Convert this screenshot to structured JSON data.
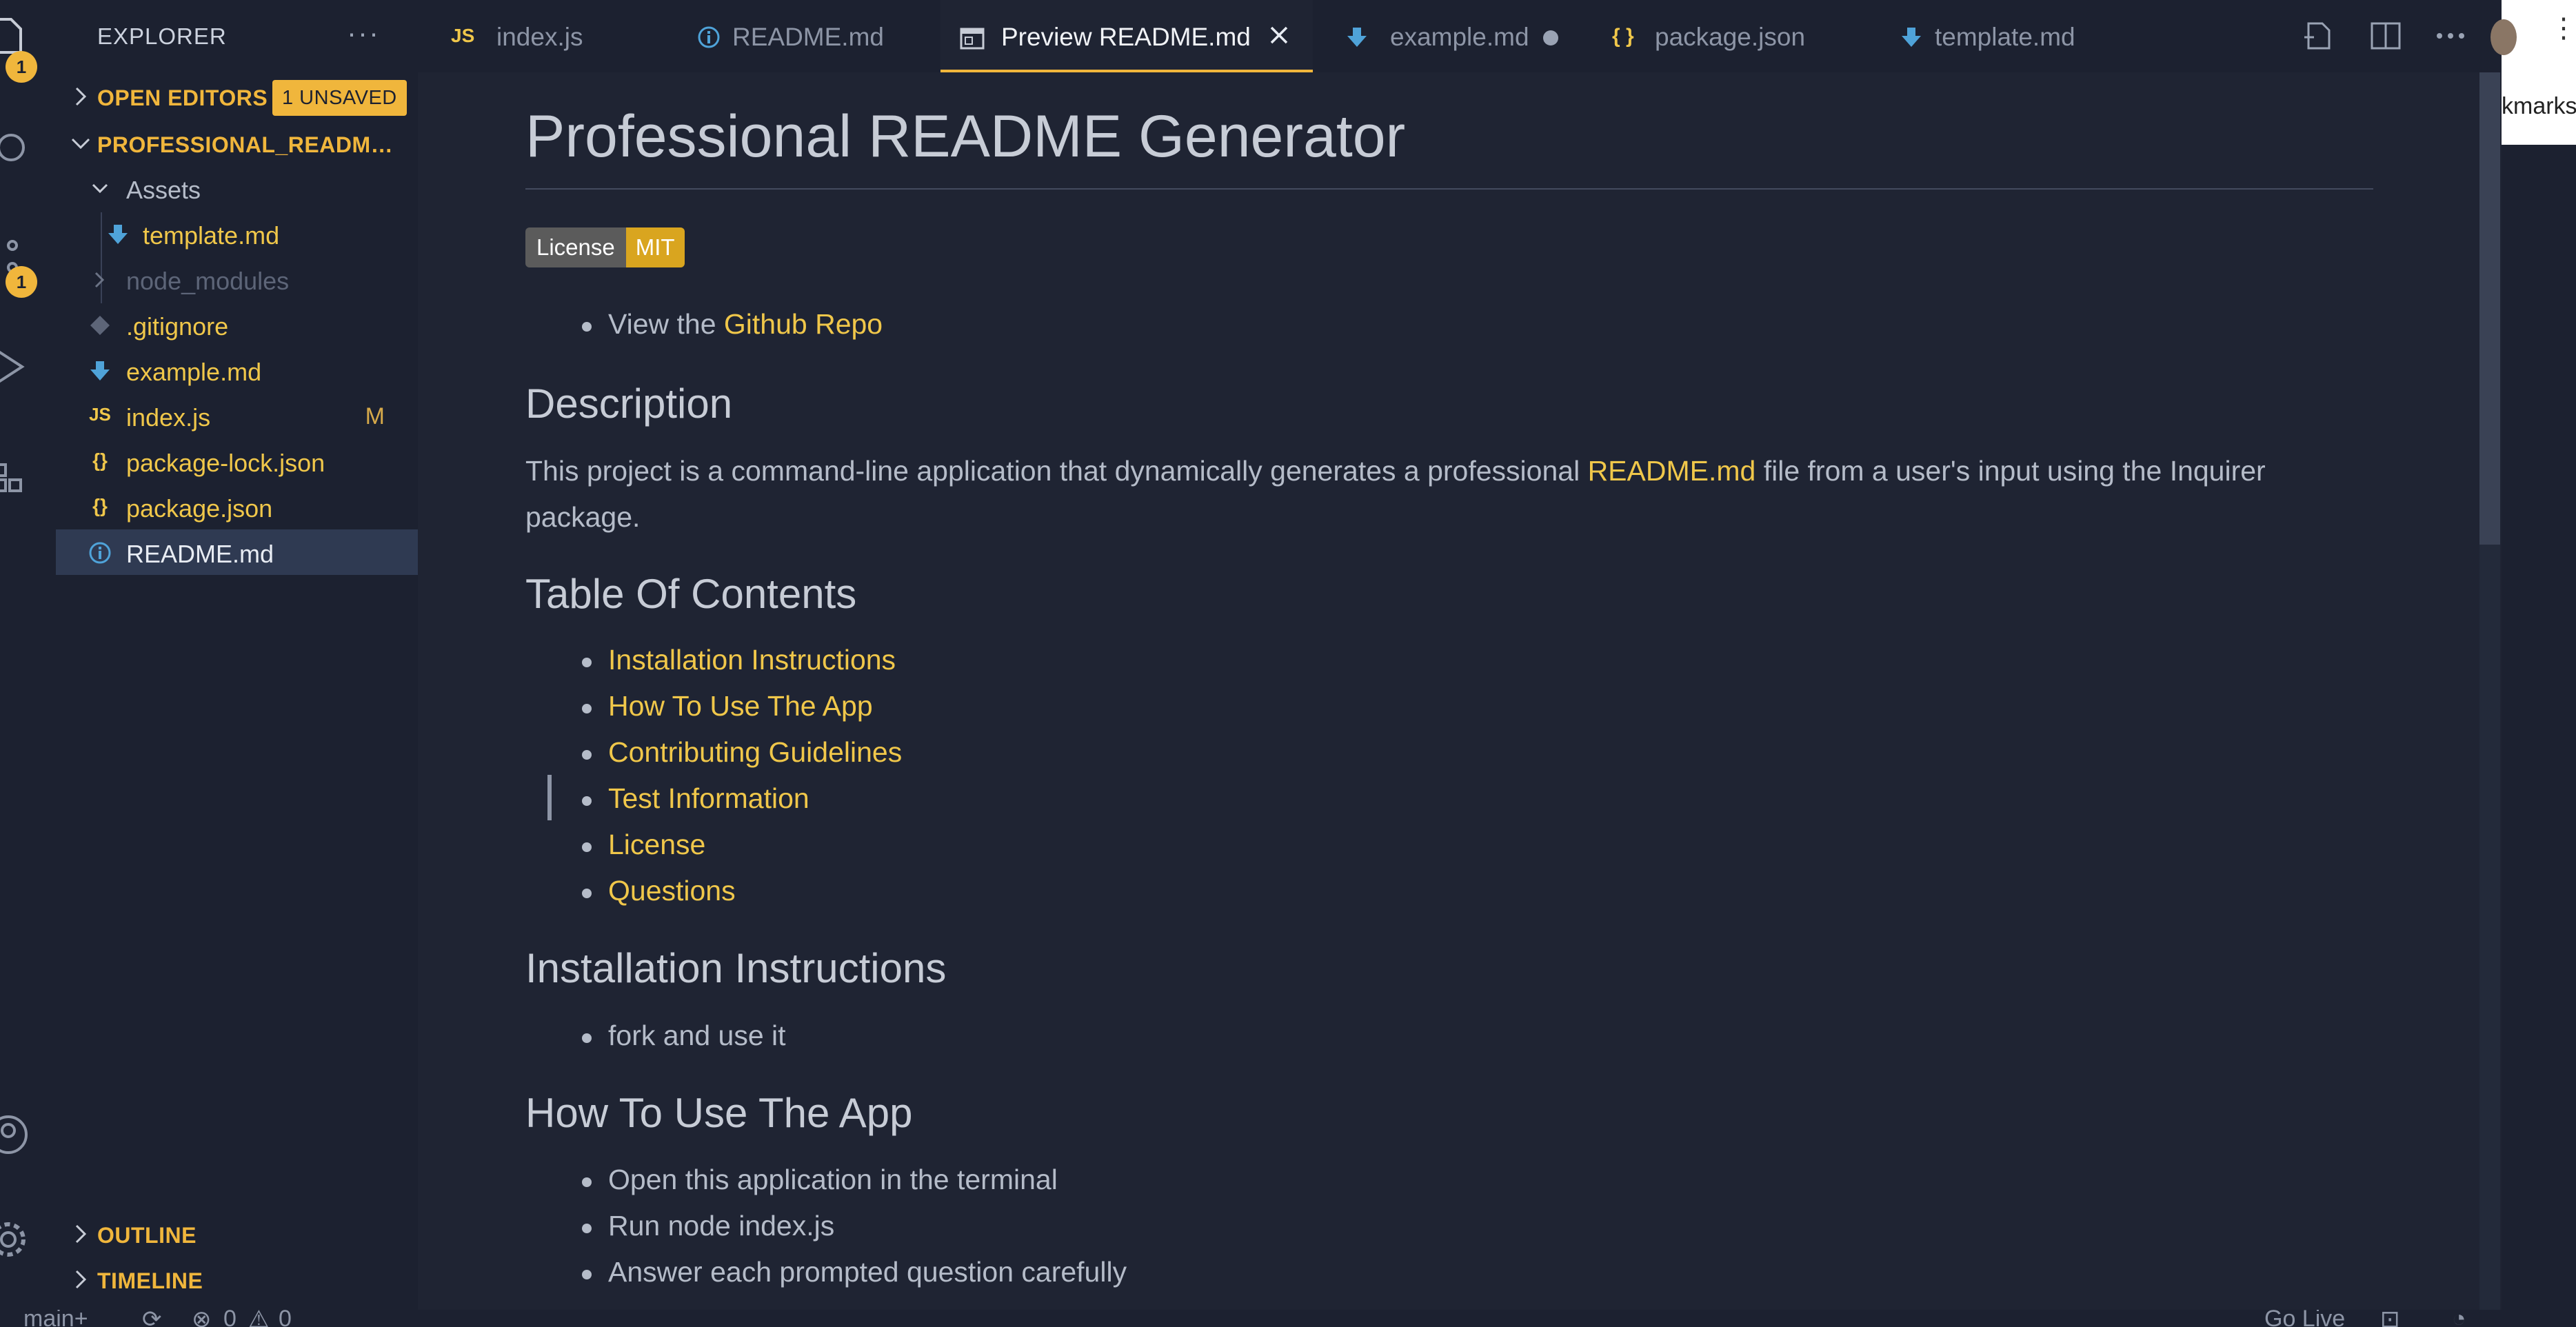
{
  "sidebar": {
    "title": "EXPLORER",
    "more": "···",
    "open_editors": {
      "label": "OPEN EDITORS",
      "badge": "1 UNSAVED"
    },
    "project": {
      "label": "PROFESSIONAL_README_G..."
    },
    "tree": [
      {
        "label": "Assets",
        "type": "folder-open",
        "modified": ""
      },
      {
        "label": "template.md",
        "type": "markdown",
        "modified": ""
      },
      {
        "label": "node_modules",
        "type": "folder-closed",
        "modified": ""
      },
      {
        "label": ".gitignore",
        "type": "git",
        "modified": ""
      },
      {
        "label": "example.md",
        "type": "markdown",
        "modified": ""
      },
      {
        "label": "index.js",
        "type": "js",
        "modified": "M"
      },
      {
        "label": "package-lock.json",
        "type": "json",
        "modified": ""
      },
      {
        "label": "package.json",
        "type": "json",
        "modified": ""
      },
      {
        "label": "README.md",
        "type": "info",
        "modified": "",
        "selected": true
      }
    ],
    "outline_label": "OUTLINE",
    "timeline_label": "TIMELINE"
  },
  "activity": {
    "explorer_badge": "1",
    "scm_badge": "1"
  },
  "tabs": [
    {
      "label": "index.js",
      "icon": "JS",
      "active": false,
      "dirty": false
    },
    {
      "label": "README.md",
      "icon": "ⓘ",
      "active": false,
      "dirty": false
    },
    {
      "label": "Preview README.md",
      "icon": "preview",
      "active": true,
      "dirty": false
    },
    {
      "label": "example.md",
      "icon": "md",
      "active": false,
      "dirty": true
    },
    {
      "label": "package.json",
      "icon": "{ }",
      "active": false,
      "dirty": false
    },
    {
      "label": "template.md",
      "icon": "md",
      "active": false,
      "dirty": false
    }
  ],
  "browser": {
    "bookmarks_fragment": "kmarks"
  },
  "preview": {
    "title": "Professional README Generator",
    "badge": {
      "left": "License",
      "right": "MIT"
    },
    "repo_line": {
      "prefix": "View the ",
      "link": "Github Repo"
    },
    "description_heading": "Description",
    "description": {
      "before": "This project is a command-line application that dynamically generates a professional ",
      "link": "README.md",
      "after": " file from a user's input using the Inquirer package."
    },
    "toc_heading": "Table Of Contents",
    "toc": [
      "Installation Instructions",
      "How To Use The App",
      "Contributing Guidelines",
      "Test Information",
      "License",
      "Questions"
    ],
    "install_heading": "Installation Instructions",
    "install_items": [
      "fork and use it"
    ],
    "usage_heading": "How To Use The App",
    "usage_items": [
      "Open this application in the terminal",
      "Run node index.js",
      "Answer each prompted question carefully"
    ]
  },
  "status": {
    "branch": "main+",
    "errors": "0",
    "warnings": "0",
    "go_live": "Go Live"
  },
  "colors": {
    "accent": "#f0b63c",
    "link": "#f0c74a",
    "background": "#1f2433",
    "sidebar": "#1c2130"
  }
}
